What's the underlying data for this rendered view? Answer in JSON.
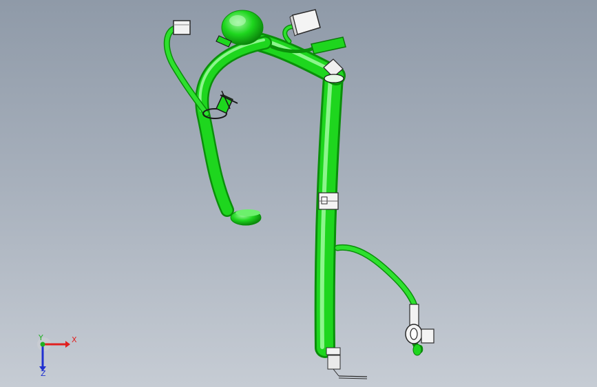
{
  "viewport": {
    "background_top": "#8f9aa8",
    "background_bottom": "#c6ccd4"
  },
  "colors": {
    "harness_green": "#1ed61e",
    "harness_green_dark": "#0a8f0a",
    "harness_green_light": "#8cf58c",
    "connector_white": "#f2f2f2",
    "connector_outline": "#2a2a2a",
    "axis_x": "#e02020",
    "axis_y": "#20b020",
    "axis_z": "#2030d0"
  },
  "triad": {
    "x_label": "X",
    "y_label": "Y",
    "z_label": "Z"
  },
  "model": {
    "name": "wire-harness-model",
    "icon": "3d-model-icon"
  }
}
